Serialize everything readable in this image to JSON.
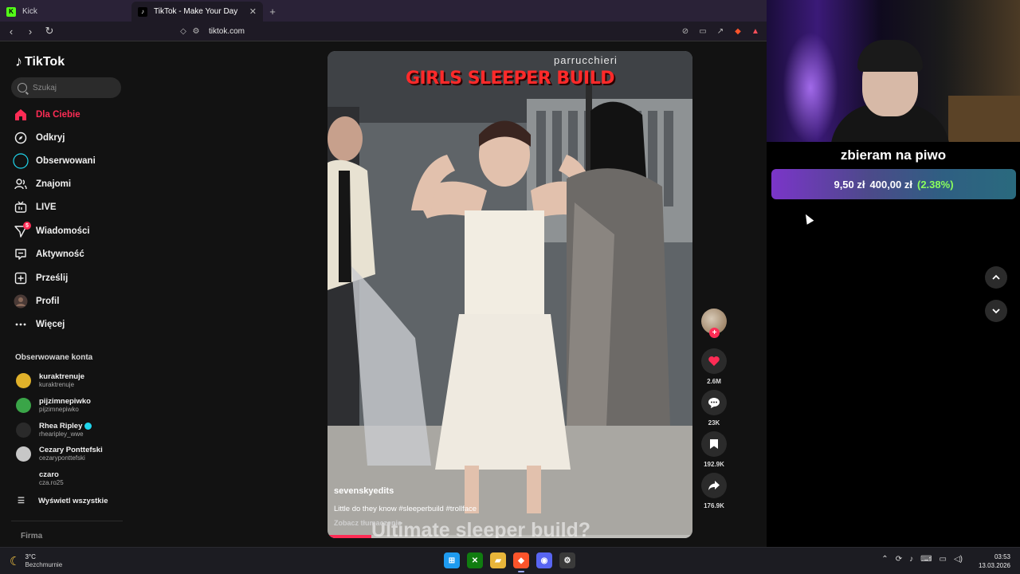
{
  "browser": {
    "tabs": [
      {
        "label": "Kick",
        "icon": "kick-favicon-icon",
        "active": false
      },
      {
        "label": "TikTok - Make Your Day",
        "icon": "tiktok-favicon-icon",
        "active": true
      }
    ],
    "url": "tiktok.com"
  },
  "tiktok": {
    "logo": "TikTok",
    "search": {
      "placeholder": "Szukaj",
      "value": ""
    },
    "nav": [
      {
        "label": "Dla Ciebie",
        "icon": "home-icon",
        "active": true
      },
      {
        "label": "Odkryj",
        "icon": "compass-icon"
      },
      {
        "label": "Obserwowani",
        "icon": "following-icon"
      },
      {
        "label": "Znajomi",
        "icon": "friends-icon"
      },
      {
        "label": "LIVE",
        "icon": "live-icon"
      },
      {
        "label": "Wiadomości",
        "icon": "messages-icon",
        "badge": "5"
      },
      {
        "label": "Aktywność",
        "icon": "activity-icon"
      },
      {
        "label": "Prześlij",
        "icon": "upload-icon"
      },
      {
        "label": "Profil",
        "icon": "profile-avatar-icon"
      },
      {
        "label": "Więcej",
        "icon": "more-icon"
      }
    ],
    "followed_title": "Obserwowane konta",
    "followed": [
      {
        "name": "kuraktrenuje",
        "handle": "kuraktrenuje",
        "color": "#e0b12a"
      },
      {
        "name": "pijzimnepiwko",
        "handle": "pijzimnepiwko",
        "color": "#3aa548"
      },
      {
        "name": "Rhea Ripley",
        "handle": "rhearipley_wwe",
        "color": "#2a2a2a",
        "verified": true
      },
      {
        "name": "Cezary Ponttefski",
        "handle": "cezaryponttefski",
        "color": "#c7c7c7"
      },
      {
        "name": "czaro",
        "handle": "cza.ro25",
        "color": "#121212"
      }
    ],
    "show_all": "Wyświetl wszystkie",
    "footer": "Firma",
    "video": {
      "title_overlay": "GIRLS SLEEPER BUILD",
      "store_sign": "parrucchieri",
      "author": "sevenskyedits",
      "description": "Little do they know #sleeperbuild #trollface",
      "translate": "Zobacz tłumaczenie",
      "subtitle": "Ultimate sleeper build?",
      "progress": 0.12
    },
    "actions": {
      "likes": "2.6M",
      "comments": "23K",
      "saves": "192.9K",
      "shares": "176.9K",
      "follow": "+"
    }
  },
  "stream": {
    "goal_title": "zbieram na piwo",
    "current": "9,50 zł",
    "target": "400,00 zł",
    "percent": "(2.38%)"
  },
  "taskbar": {
    "weather_temp": "3°C",
    "weather_desc": "Bezchmurnie",
    "time": "03:53",
    "date": "13.03.2026"
  }
}
